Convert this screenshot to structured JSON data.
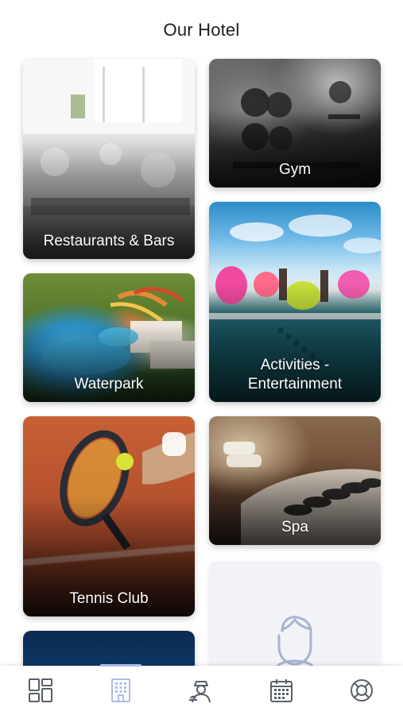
{
  "header": {
    "title": "Our Hotel"
  },
  "cards": {
    "restaurants": {
      "label": "Restaurants & Bars",
      "icon": "restaurant-photo"
    },
    "gym": {
      "label": "Gym",
      "icon": "gym-photo"
    },
    "activities": {
      "label": "Activities - Entertainment",
      "icon": "pool-activities-photo"
    },
    "waterpark": {
      "label": "Waterpark",
      "icon": "waterpark-photo"
    },
    "spa": {
      "label": "Spa",
      "icon": "spa-stones-photo"
    },
    "tennis": {
      "label": "Tennis Club",
      "icon": "tennis-photo"
    },
    "next": {
      "label": "",
      "icon": "night-photo"
    },
    "placeholder": {
      "icon": "person-placeholder-icon"
    }
  },
  "tabbar": {
    "active_index": 1,
    "active_color": "#aebbe6",
    "inactive_color": "#5a5f6a",
    "items": [
      {
        "icon": "dashboard-icon"
      },
      {
        "icon": "hotel-building-icon"
      },
      {
        "icon": "concierge-icon"
      },
      {
        "icon": "calendar-icon"
      },
      {
        "icon": "lifebuoy-icon"
      }
    ]
  }
}
